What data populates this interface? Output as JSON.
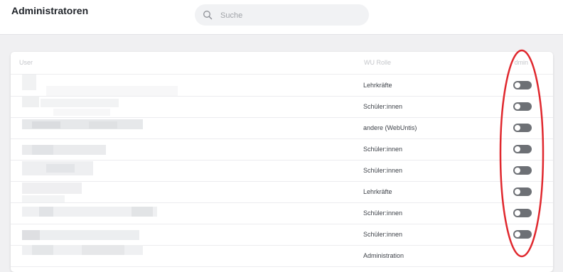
{
  "header": {
    "title": "Administratoren",
    "search_placeholder": "Suche",
    "search_value": ""
  },
  "table": {
    "columns": {
      "user": "User",
      "role": "WU Rolle",
      "admin": "dmin"
    },
    "rows": [
      {
        "role": "Lehrkräfte",
        "admin": false
      },
      {
        "role": "Schüler:innen",
        "admin": false
      },
      {
        "role": "andere (WebUntis)",
        "admin": false
      },
      {
        "role": "Schüler:innen",
        "admin": false
      },
      {
        "role": "Schüler:innen",
        "admin": false
      },
      {
        "role": "Lehrkräfte",
        "admin": false
      },
      {
        "role": "Schüler:innen",
        "admin": false
      },
      {
        "role": "Schüler:innen",
        "admin": false
      },
      {
        "role": "Administration",
        "admin": false
      }
    ]
  },
  "colors": {
    "toggle_off": "#6d7075",
    "highlight_ring": "#e0282e"
  }
}
